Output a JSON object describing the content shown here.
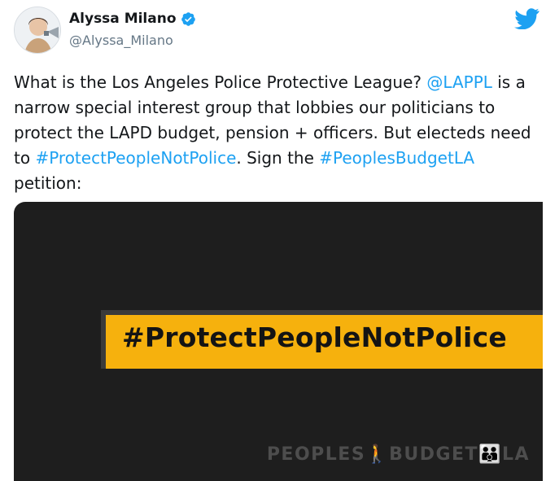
{
  "user": {
    "name": "Alyssa Milano",
    "handle": "@Alyssa_Milano",
    "verified": true,
    "verified_color": "#1da1f2"
  },
  "brand_icon": "twitter-bird-icon",
  "tweet": {
    "p1": "What is the Los Angeles Police Protective League? ",
    "mention": "@LAPPL",
    "p2": " is a narrow special interest group that lobbies our politicians to protect the LAPD budget, pension + officers. But electeds need to ",
    "hashtag1": "#ProtectPeopleNotPolice",
    "p3": ". Sign the ",
    "hashtag2": "#PeoplesBudgetLA",
    "p4": " petition:"
  },
  "media": {
    "banner_text": "#ProtectPeopleNotPolice",
    "wordmark": "PEOPLES🚶BUDGET👪LA",
    "banner_color": "#f6b10d",
    "background_color": "#1e1e1e"
  }
}
